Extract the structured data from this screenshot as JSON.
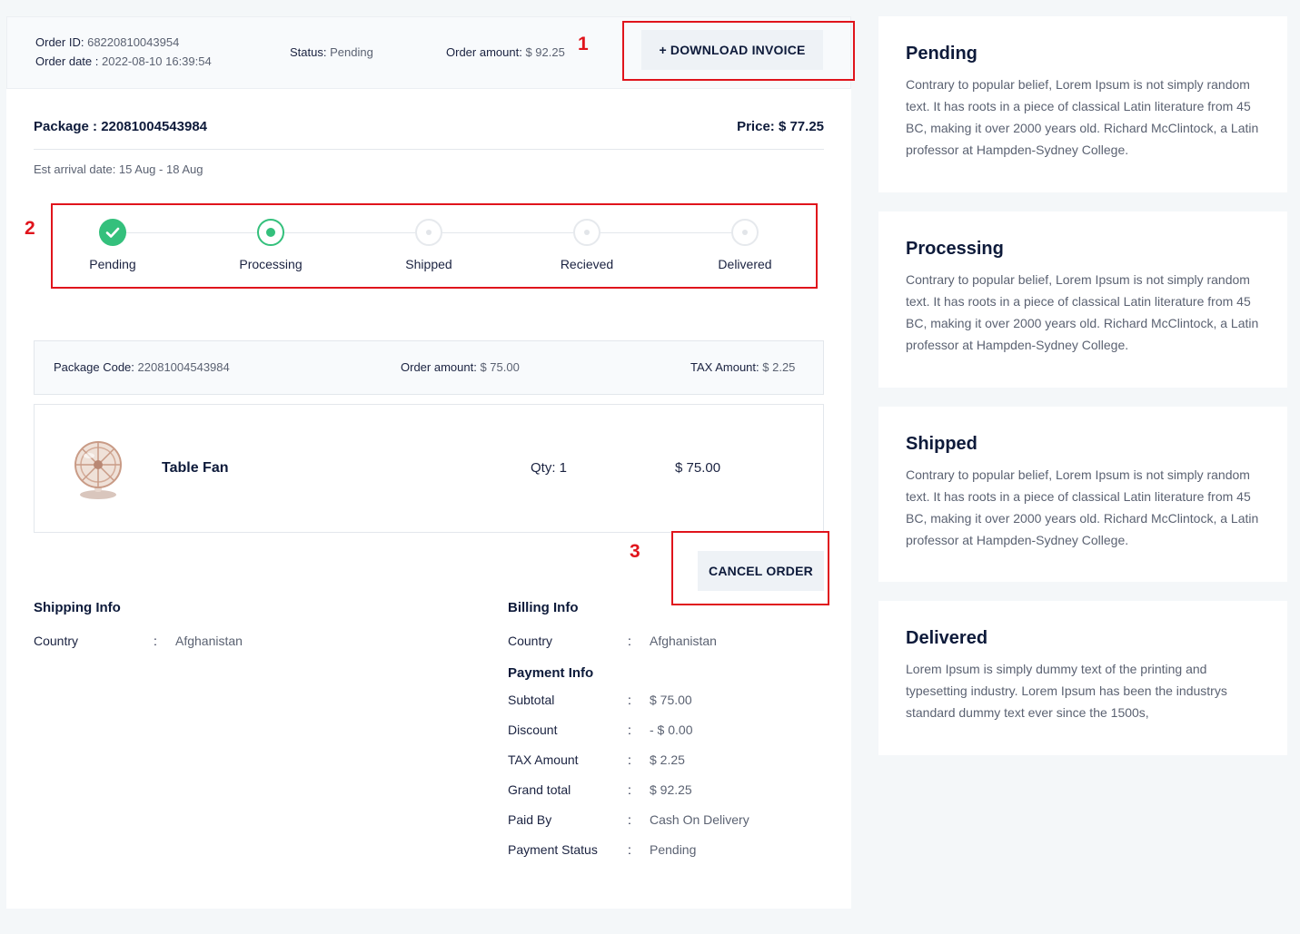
{
  "order": {
    "id_label": "Order ID:",
    "id": "68220810043954",
    "date_label": "Order date :",
    "date": "2022-08-10 16:39:54",
    "status_label": "Status:",
    "status": "Pending",
    "amount_label": "Order amount:",
    "amount": "$ 92.25",
    "download_label": "+ DOWNLOAD INVOICE"
  },
  "package": {
    "title": "Package : 22081004543984",
    "price": "Price: $ 77.25",
    "arrival": "Est arrival date: 15 Aug - 18 Aug"
  },
  "steps": [
    {
      "label": "Pending",
      "state": "done"
    },
    {
      "label": "Processing",
      "state": "current"
    },
    {
      "label": "Shipped",
      "state": "todo"
    },
    {
      "label": "Recieved",
      "state": "todo"
    },
    {
      "label": "Delivered",
      "state": "todo"
    }
  ],
  "package_bar": {
    "code_label": "Package Code:",
    "code": "22081004543984",
    "amount_label": "Order amount:",
    "amount": "$ 75.00",
    "tax_label": "TAX Amount:",
    "tax": "$ 2.25"
  },
  "item": {
    "name": "Table Fan",
    "qty": "Qty: 1",
    "price": "$ 75.00",
    "image_icon": "table-fan-image"
  },
  "cancel_label": "CANCEL ORDER",
  "annotations": [
    "1",
    "2",
    "3"
  ],
  "shipping": {
    "title": "Shipping Info",
    "rows": [
      {
        "key": "Country",
        "value": "Afghanistan"
      }
    ]
  },
  "billing": {
    "title": "Billing Info",
    "rows": [
      {
        "key": "Country",
        "value": "Afghanistan"
      }
    ]
  },
  "payment": {
    "title": "Payment Info",
    "rows": [
      {
        "key": "Subtotal",
        "value": "$ 75.00"
      },
      {
        "key": "Discount",
        "value": "- $ 0.00"
      },
      {
        "key": "TAX Amount",
        "value": "$ 2.25"
      },
      {
        "key": "Grand total",
        "value": "$ 92.25"
      },
      {
        "key": "Paid By",
        "value": "Cash On Delivery"
      },
      {
        "key": "Payment Status",
        "value": "Pending"
      }
    ]
  },
  "separator": ":",
  "cards": [
    {
      "title": "Pending",
      "body": "Contrary to popular belief, Lorem Ipsum is not simply random text. It has roots in a piece of classical Latin literature from 45 BC, making it over 2000 years old. Richard McClintock, a Latin professor at Hampden-Sydney College."
    },
    {
      "title": "Processing",
      "body": "Contrary to popular belief, Lorem Ipsum is not simply random text. It has roots in a piece of classical Latin literature from 45 BC, making it over 2000 years old. Richard McClintock, a Latin professor at Hampden-Sydney College."
    },
    {
      "title": "Shipped",
      "body": "Contrary to popular belief, Lorem Ipsum is not simply random text. It has roots in a piece of classical Latin literature from 45 BC, making it over 2000 years old. Richard McClintock, a Latin professor at Hampden-Sydney College."
    },
    {
      "title": "Delivered",
      "body": "Lorem Ipsum is simply dummy text of the printing and typesetting industry. Lorem Ipsum has been the industrys standard dummy text ever since the 1500s,"
    }
  ],
  "colors": {
    "accent_green": "#34c07c",
    "annotation_red": "#e0141c",
    "heading": "#0d1a3a"
  }
}
